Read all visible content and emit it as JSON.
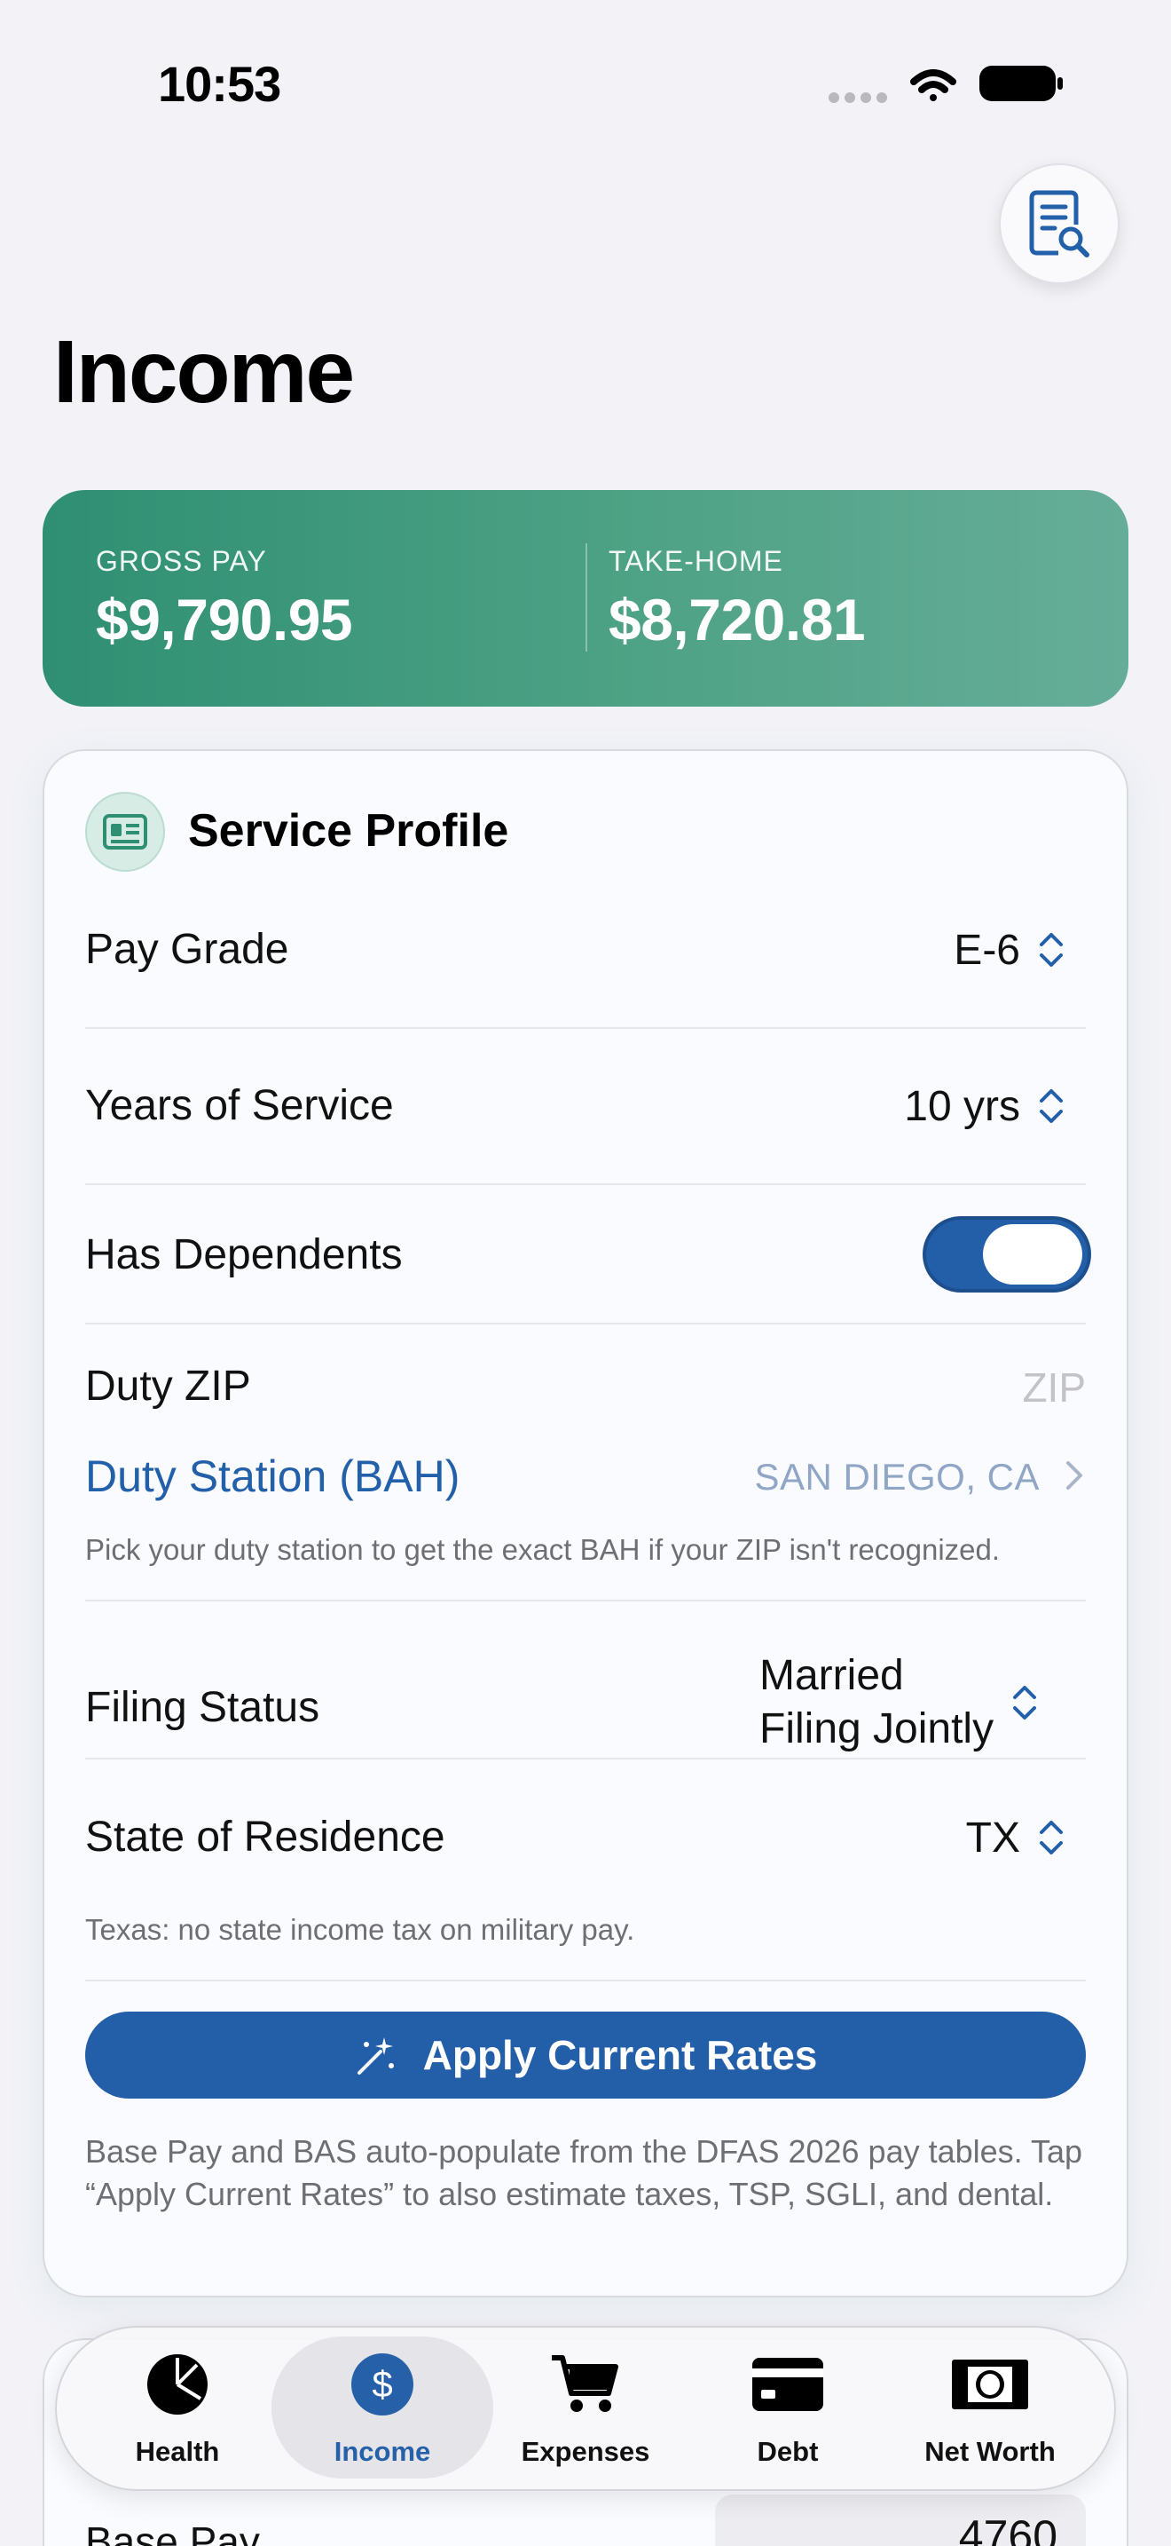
{
  "status_bar": {
    "time": "10:53"
  },
  "header": {
    "title": "Income",
    "report_icon": "document-search-icon"
  },
  "summary": {
    "gross_label": "GROSS PAY",
    "gross_value": "$9,790.95",
    "takehome_label": "TAKE-HOME",
    "takehome_value": "$8,720.81",
    "gradient_colors": [
      "#2f8f72",
      "#66ad98"
    ]
  },
  "service_profile": {
    "title": "Service Profile",
    "icon": "id-card-icon",
    "pay_grade": {
      "label": "Pay Grade",
      "value": "E-6"
    },
    "years_of_service": {
      "label": "Years of Service",
      "value": "10 yrs"
    },
    "has_dependents": {
      "label": "Has Dependents",
      "on": true
    },
    "duty_zip": {
      "label": "Duty ZIP",
      "placeholder": "ZIP"
    },
    "duty_station": {
      "label": "Duty Station (BAH)",
      "value": "SAN DIEGO, CA"
    },
    "duty_note": "Pick your duty station to get the exact BAH if your ZIP isn't recognized.",
    "filing_status": {
      "label": "Filing Status",
      "value_line1": "Married",
      "value_line2": "Filing Jointly"
    },
    "state_of_residence": {
      "label": "State of Residence",
      "value": "TX"
    },
    "state_note": "Texas: no state income tax on military pay.",
    "apply_button": "Apply Current Rates",
    "footer_note": "Base Pay and BAS auto-populate from the DFAS 2026 pay tables. Tap “Apply Current Rates” to also estimate taxes, TSP, SGLI, and dental."
  },
  "entitlements": {
    "base_pay_label": "Base Pay",
    "base_pay_value": "4760"
  },
  "tab_bar": {
    "active": "Income",
    "tabs": [
      {
        "label": "Health",
        "icon": "pie-chart-icon"
      },
      {
        "label": "Income",
        "icon": "dollar-circle-icon"
      },
      {
        "label": "Expenses",
        "icon": "cart-icon"
      },
      {
        "label": "Debt",
        "icon": "credit-card-icon"
      },
      {
        "label": "Net Worth",
        "icon": "banknote-icon"
      }
    ]
  },
  "colors": {
    "accent": "#235ea8",
    "link": "#2260aa",
    "background": "#f2f2f7"
  }
}
